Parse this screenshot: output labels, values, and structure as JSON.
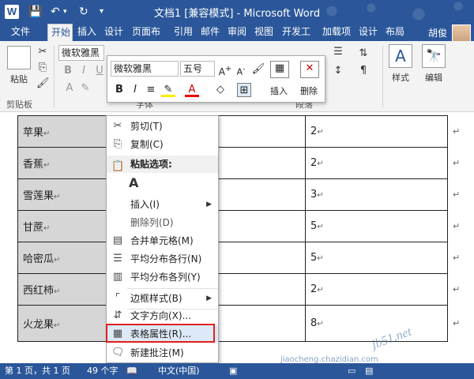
{
  "titlebar": {
    "app_logo": "W",
    "title": "文档1 [兼容模式] - Microsoft Word",
    "icons": [
      "save-icon",
      "undo-icon",
      "redo-icon",
      "customize-icon"
    ]
  },
  "tabs": [
    "文件",
    "开始",
    "插入",
    "设计",
    "页面布",
    "引用",
    "邮件",
    "审阅",
    "视图",
    "开发工",
    "加载项",
    "设计",
    "布局"
  ],
  "user": "胡俊",
  "ribbon": {
    "paste_label": "粘贴",
    "clipboard_label": "剪贴板",
    "font_name": "微软雅黑",
    "font_group_label": "字体",
    "paragraph_label": "段落",
    "style_label": "样式",
    "edit_label": "编辑"
  },
  "mini_toolbar": {
    "font_name": "微软雅黑",
    "font_size": "五号",
    "insert_label": "插入",
    "delete_label": "删除"
  },
  "table": {
    "rows": [
      {
        "name": "苹果",
        "value": "2"
      },
      {
        "name": "香蕉",
        "value": "2"
      },
      {
        "name": "雪莲果",
        "value": "3"
      },
      {
        "name": "甘蔗",
        "value": "5"
      },
      {
        "name": "哈密瓜",
        "value": "5"
      },
      {
        "name": "西红柿",
        "value": "2"
      },
      {
        "name": "火龙果",
        "value": "8"
      }
    ]
  },
  "context_menu": {
    "cut": "剪切(T)",
    "copy": "复制(C)",
    "paste_header": "粘贴选项:",
    "insert": "插入(I)",
    "delete_col": "删除列(D)",
    "merge": "合并单元格(M)",
    "distribute_rows": "平均分布各行(N)",
    "distribute_cols": "平均分布各列(Y)",
    "border_style": "边框样式(B)",
    "text_direction": "文字方向(X)...",
    "table_props": "表格属性(R)...",
    "new_comment": "新建批注(M)"
  },
  "status": {
    "page": "第 1 页，共 1 页",
    "words": "49 个字",
    "lang": "中文(中国)"
  },
  "watermark": {
    "text": "jb51.net",
    "url": "jiaocheng.chazidian.com"
  },
  "colors": {
    "accent": "#2b579a",
    "highlight": "#dde9f6",
    "red_box": "#e0201b"
  }
}
